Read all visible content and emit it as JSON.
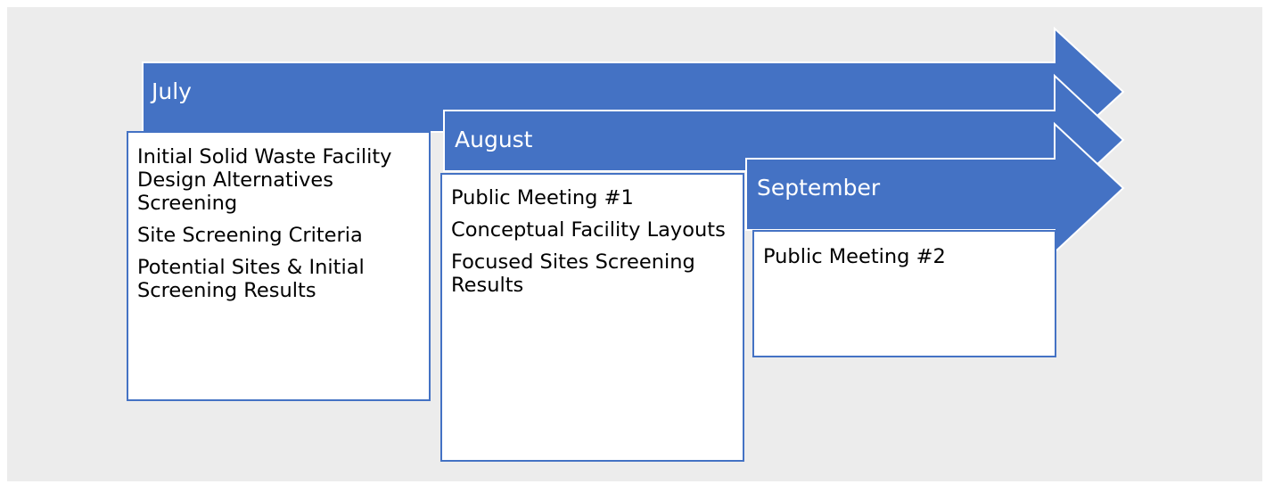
{
  "diagram": {
    "arrow_color": "#4472c4",
    "background_color": "#ececec",
    "months": [
      {
        "label": "July",
        "items": [
          "Initial Solid Waste Facility Design Alternatives Screening",
          "Site Screening Criteria",
          "Potential Sites & Initial Screening Results"
        ]
      },
      {
        "label": "August",
        "items": [
          "Public Meeting #1",
          "Conceptual Facility Layouts",
          "Focused Sites Screening Results"
        ]
      },
      {
        "label": "September",
        "items": [
          "Public Meeting #2"
        ]
      }
    ]
  }
}
